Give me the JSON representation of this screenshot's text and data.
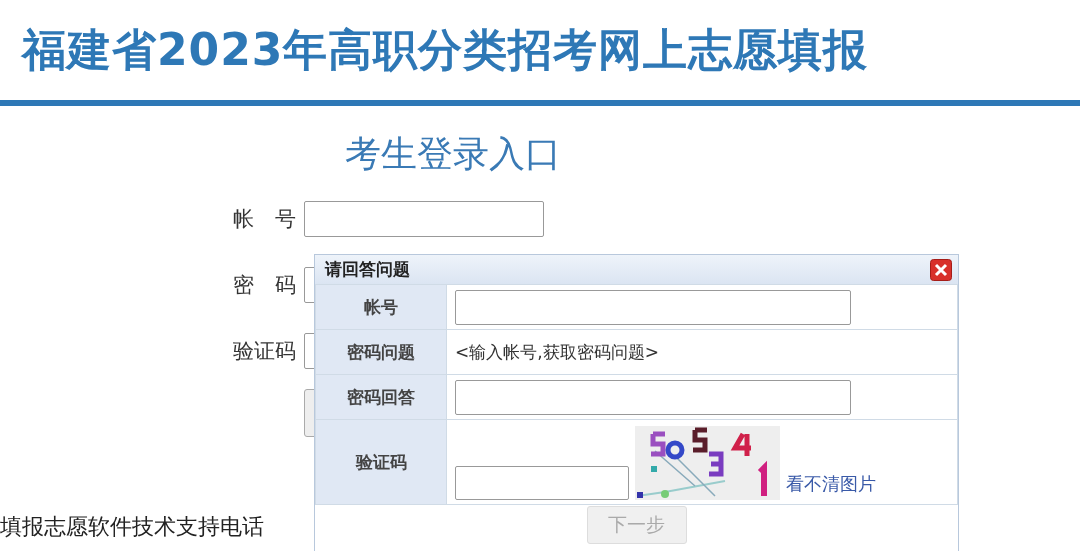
{
  "header": {
    "title": "福建省2023年高职分类招考网上志愿填报"
  },
  "login": {
    "heading": "考生登录入口",
    "fields": [
      {
        "label": "帐　号"
      },
      {
        "label": "密　码"
      },
      {
        "label": "验证码"
      }
    ]
  },
  "footer": {
    "support_label": "填报志愿软件技术支持电话"
  },
  "dialog": {
    "title": "请回答问题",
    "rows": [
      {
        "kind": "input",
        "label": "帐号"
      },
      {
        "kind": "text",
        "label": "密码问题",
        "value": "<输入帐号,获取密码问题>"
      },
      {
        "kind": "input",
        "label": "密码回答"
      },
      {
        "kind": "captcha",
        "label": "验证码",
        "link": "看不清图片"
      }
    ],
    "next_button": {
      "label": "下一步",
      "disabled": true
    }
  }
}
